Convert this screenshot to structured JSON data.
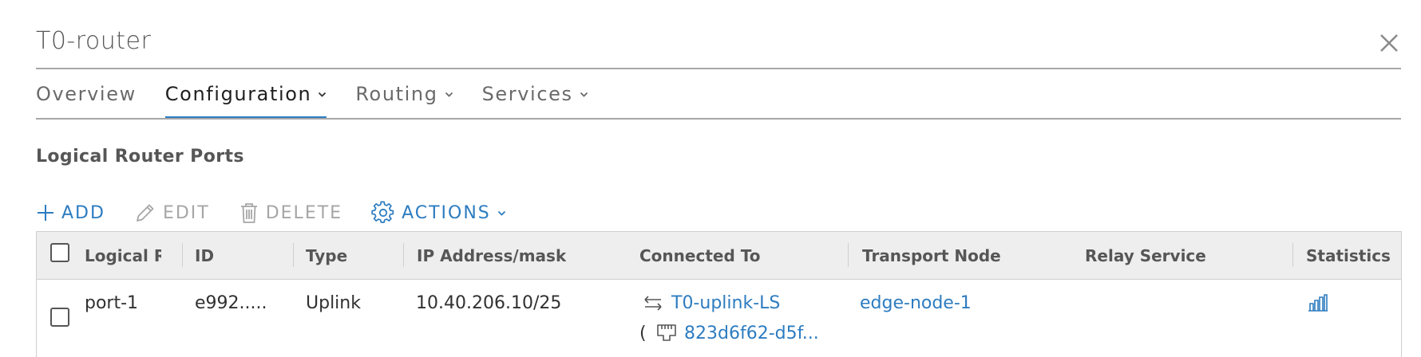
{
  "header": {
    "title": "T0-router",
    "close_icon": "close-icon"
  },
  "tabs": [
    {
      "label": "Overview",
      "has_dropdown": false,
      "active": false
    },
    {
      "label": "Configuration",
      "has_dropdown": true,
      "active": true
    },
    {
      "label": "Routing",
      "has_dropdown": true,
      "active": false
    },
    {
      "label": "Services",
      "has_dropdown": true,
      "active": false
    }
  ],
  "section": {
    "title": "Logical Router Ports"
  },
  "toolbar": {
    "add_label": "ADD",
    "edit_label": "EDIT",
    "delete_label": "DELETE",
    "actions_label": "ACTIONS"
  },
  "table": {
    "columns": [
      "Logical Router Port",
      "ID",
      "Type",
      "IP Address/mask",
      "Connected To",
      "Transport Node",
      "Relay Service",
      "Statistics"
    ],
    "rows": [
      {
        "name": "port-1",
        "id": "e992.....",
        "type": "Uplink",
        "ip": "10.40.206.10/25",
        "connected_switch": "T0-uplink-LS",
        "connected_port_prefix": "(",
        "connected_port": "823d6f62-d5f...",
        "transport_node": "edge-node-1",
        "relay_service": "",
        "statistics_icon": "bar-chart-icon"
      }
    ]
  },
  "colors": {
    "accent": "#2d7cc0",
    "text": "#313131",
    "muted": "#a6a6a6",
    "header_bg": "#eeeeee"
  }
}
